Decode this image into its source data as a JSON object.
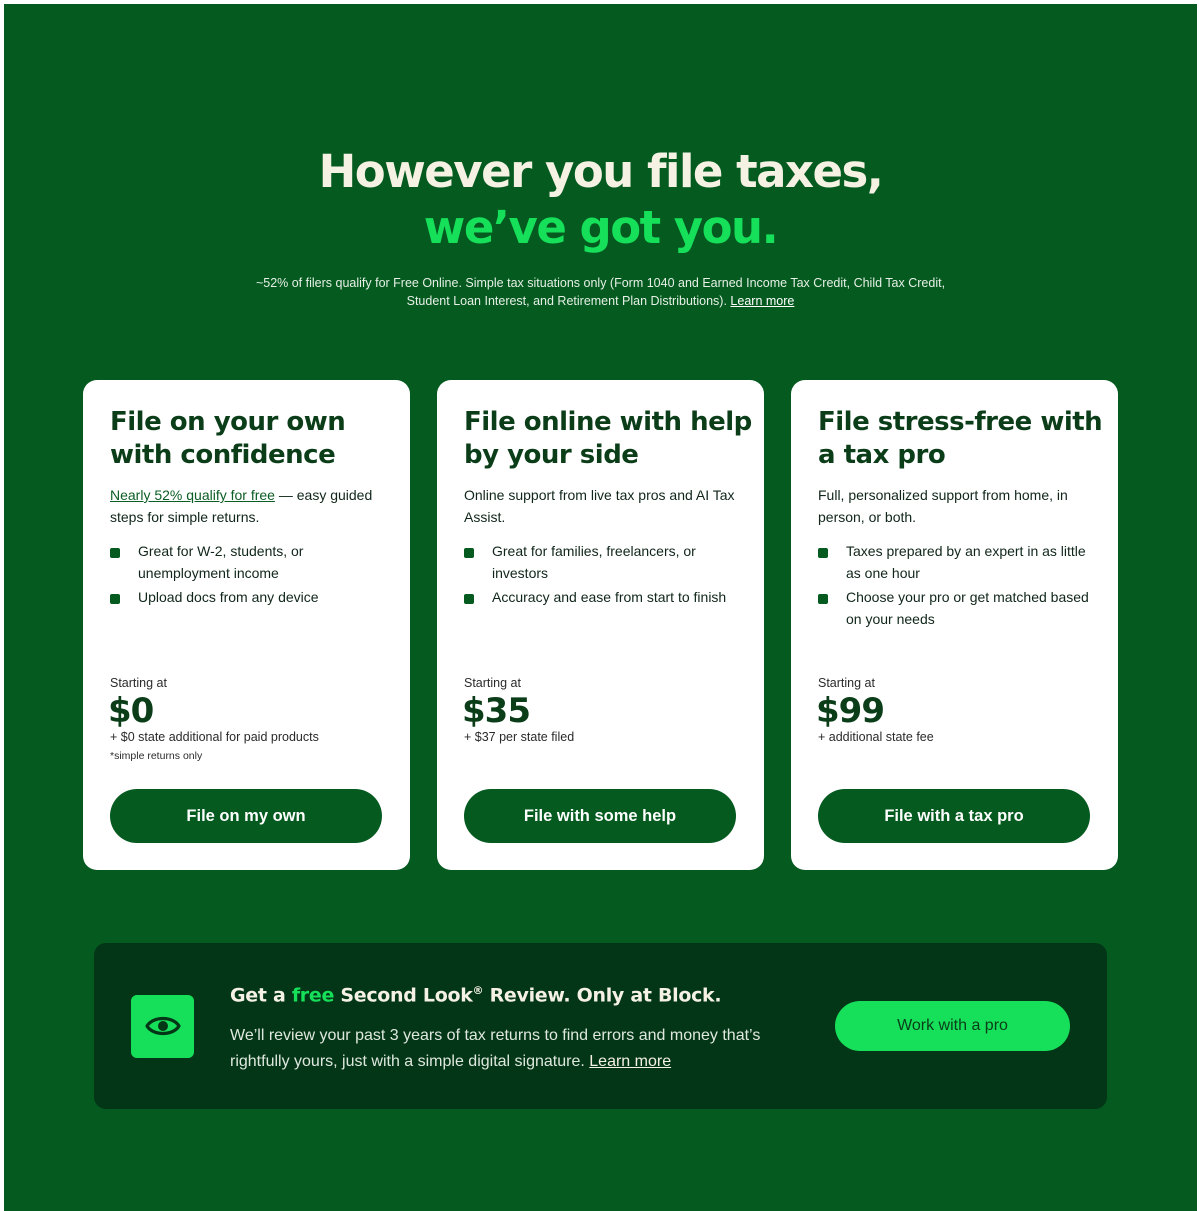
{
  "hero": {
    "line1": "However you file taxes,",
    "line2": "we’ve got you.",
    "disclaimer": "~52% of filers qualify for Free Online. Simple tax situations only (Form 1040 and Earned Income Tax Credit, Child Tax Credit, Student Loan Interest, and Retirement Plan Distributions).",
    "learn_more": "Learn more"
  },
  "cards": [
    {
      "title": "File on your own with confidence",
      "desc_link": "Nearly 52% qualify for free",
      "desc": " — easy guided steps for simple returns.",
      "bullets": [
        "Great for W-2, students, or unemployment income",
        "Upload docs from any device"
      ],
      "starting_at": "Starting at",
      "price": "$0",
      "fee": "+  $0 state additional for paid products",
      "fine": "*simple returns only",
      "button": "File on my own"
    },
    {
      "title": "File online with help by your side",
      "desc": "Online support from live tax pros and AI Tax Assist.",
      "bullets": [
        "Great for families, freelancers, or investors",
        "Accuracy and ease from start to finish"
      ],
      "starting_at": "Starting at",
      "price": "$35",
      "fee": "+ $37 per state filed",
      "button": "File with some help"
    },
    {
      "title": "File stress-free with a tax pro",
      "desc": "Full, personalized support from home, in person, or both.",
      "bullets": [
        "Taxes prepared by an expert in as little as one hour",
        "Choose your pro or get matched based on your needs"
      ],
      "starting_at": "Starting at",
      "price": "$99",
      "fee": "+ additional state fee",
      "button": "File with a tax pro"
    }
  ],
  "banner": {
    "icon": "eye-icon",
    "title_pre": "Get a ",
    "title_free": "free",
    "title_post": " Second Look",
    "title_reg": "®",
    "title_end": " Review. Only at Block.",
    "body": "We’ll review your past 3 years of tax returns to find errors and money that’s rightfully yours, just with a simple digital signature.",
    "learn_more": "Learn more",
    "cta": "Work with a pro"
  },
  "colors": {
    "background": "#045a1f",
    "accent": "#16e05a",
    "banner_bg": "#033616",
    "heading_dark": "#0a3d18",
    "hero_text": "#f5f1e3"
  }
}
